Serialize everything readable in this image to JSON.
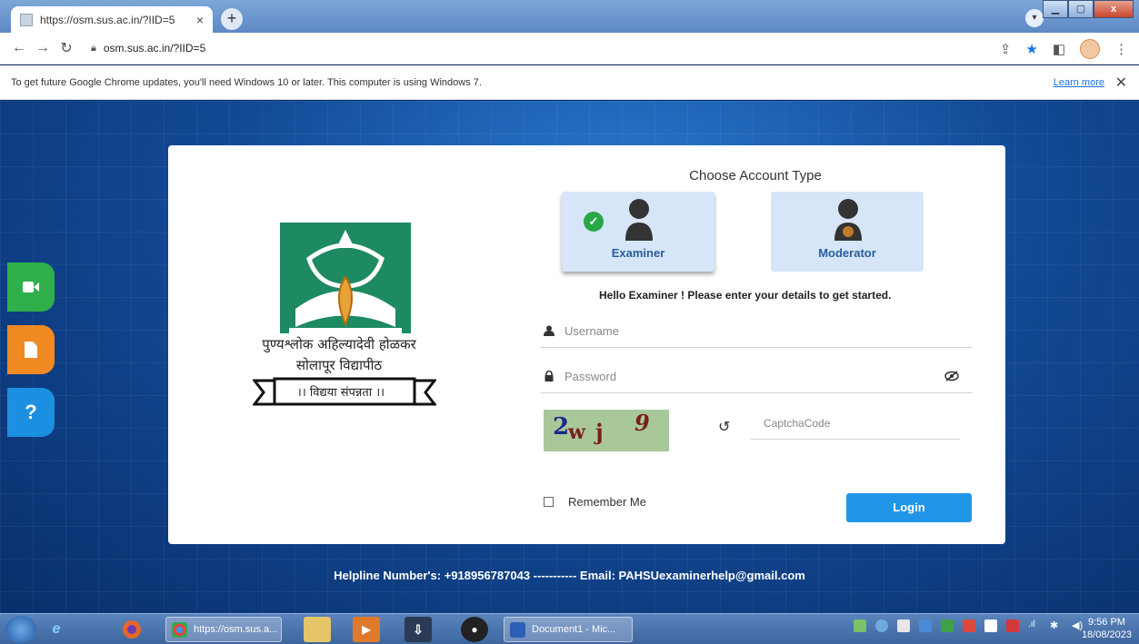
{
  "browser": {
    "tab_title": "https://osm.sus.ac.in/?IID=5",
    "tab_close": "×",
    "new_tab": "+",
    "url": "osm.sus.ac.in/?IID=5",
    "infobar_text": "To get future Google Chrome updates, you'll need Windows 10 or later. This computer is using Windows 7.",
    "learn_more": "Learn more",
    "infobar_close": "✕"
  },
  "sidebar": {
    "video_icon": "video-camera-icon",
    "document_icon": "document-icon",
    "help_label": "?"
  },
  "logo": {
    "line1": "पुण्यश्लोक अहिल्यादेवी होळकर",
    "line2": "सोलापूर विद्यापीठ",
    "motto": "।। विद्यया संपन्नता ।।"
  },
  "login": {
    "choose_title": "Choose Account Type",
    "accounts": [
      {
        "label": "Examiner",
        "selected": true
      },
      {
        "label": "Moderator",
        "selected": false
      }
    ],
    "hello": "Hello Examiner ! Please enter your details to get started.",
    "username_placeholder": "Username",
    "password_placeholder": "Password",
    "captcha_chars": [
      "2",
      "w",
      "j",
      "9"
    ],
    "captcha_placeholder": "CaptchaCode",
    "remember_label": "Remember Me",
    "login_label": "Login"
  },
  "footer": {
    "helpline": "Helpline Number's: +918956787043 ----------- Email: PAHSUexaminerhelp@gmail.com"
  },
  "taskbar": {
    "chrome_window": "https://osm.sus.a...",
    "word_window": "Document1 - Mic...",
    "time": "9:56 PM",
    "date": "18/08/2023"
  },
  "colors": {
    "accent": "#2196e8",
    "account_bg": "#d6e6f8",
    "account_label": "#2a5d99",
    "check": "#28a745",
    "logo_green": "#1e8a62"
  }
}
